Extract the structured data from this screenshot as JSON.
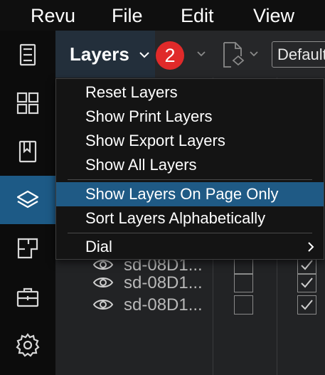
{
  "menubar": {
    "items": [
      "Revu",
      "File",
      "Edit",
      "View"
    ]
  },
  "sidebar": {
    "items": [
      {
        "icon": "document-icon",
        "active": false
      },
      {
        "icon": "thumbnails-icon",
        "active": false
      },
      {
        "icon": "bookmark-icon",
        "active": false
      },
      {
        "icon": "layers-icon",
        "active": true
      },
      {
        "icon": "spaces-icon",
        "active": false
      },
      {
        "icon": "toolbox-icon",
        "active": false
      },
      {
        "icon": "settings-gear-icon",
        "active": false
      }
    ]
  },
  "panel": {
    "title": "Layers",
    "badge": "2",
    "profile_value": "Default"
  },
  "dropdown": {
    "items": [
      {
        "label": "Reset Layers"
      },
      {
        "label": "Show Print Layers"
      },
      {
        "label": "Show Export Layers"
      },
      {
        "label": "Show All Layers"
      },
      {
        "label": "Show Layers On Page Only",
        "highlighted": true
      },
      {
        "label": "Sort Layers Alphabetically"
      },
      {
        "label": "Dial",
        "submenu": true
      }
    ]
  },
  "layers_table": {
    "rows": [
      {
        "name": "sd-08D1...",
        "col2_checked": false,
        "col3_checked": true
      },
      {
        "name": "sd-08D1...",
        "col2_checked": false,
        "col3_checked": true
      },
      {
        "name": "sd-08D1...",
        "col2_checked": false,
        "col3_checked": true
      }
    ]
  },
  "colors": {
    "accent": "#1d5a86",
    "badge": "#e02a2a",
    "menubar_bg": "#0f0f0f"
  }
}
